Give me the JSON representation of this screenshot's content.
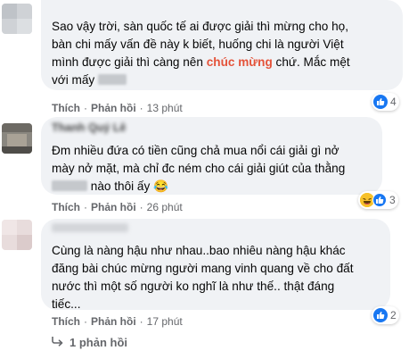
{
  "comments": [
    {
      "text_line1": "Sao vậy trời, sàn quốc tế ai được giải thì mừng cho họ,",
      "text_line2": "bàn chi mấy vấn đề này k biết, huống chi là người Việt",
      "text_line3_pre": "mình được giải thì càng nên",
      "text_line3_hl": "chúc mừng",
      "text_line3_post": "chứ. Mắc mệt",
      "text_line4_pre": "với mấy",
      "like_label": "Thích",
      "reply_label": "Phản hồi",
      "time": "13 phút",
      "reaction_icon": "like-icon",
      "reaction_count": "4"
    },
    {
      "author": "Thanh Quý Lê",
      "text_line1": "Đm nhiều đứa có tiền cũng chả mua nổi cái giải gì nở",
      "text_line2": "mày nở mặt, mà chỉ đc ném cho cái giải giút của thằng",
      "text_line3_post": "nào thôi ấy 😂",
      "like_label": "Thích",
      "reply_label": "Phản hồi",
      "time": "26 phút",
      "reaction_icons": [
        "haha-icon",
        "like-icon"
      ],
      "reaction_count": "3"
    },
    {
      "text_line1": "Cùng là nàng hậu như nhau..bao nhiêu nàng hậu khác",
      "text_line2": "đăng bài chúc mừng người mang vinh quang về cho đất",
      "text_line3": "nước thì một số người ko nghĩ là như thế.. thật đáng",
      "text_line4": "tiếc...",
      "like_label": "Thích",
      "reply_label": "Phản hồi",
      "time": "17 phút",
      "reaction_icon": "like-icon",
      "reaction_count": "2"
    }
  ],
  "replies_link": "1 phản hồi",
  "colors": {
    "bubble": "#f0f2f5",
    "like_blue": "#1877f2",
    "highlight": "#e4533a",
    "muted": "#65676b"
  }
}
